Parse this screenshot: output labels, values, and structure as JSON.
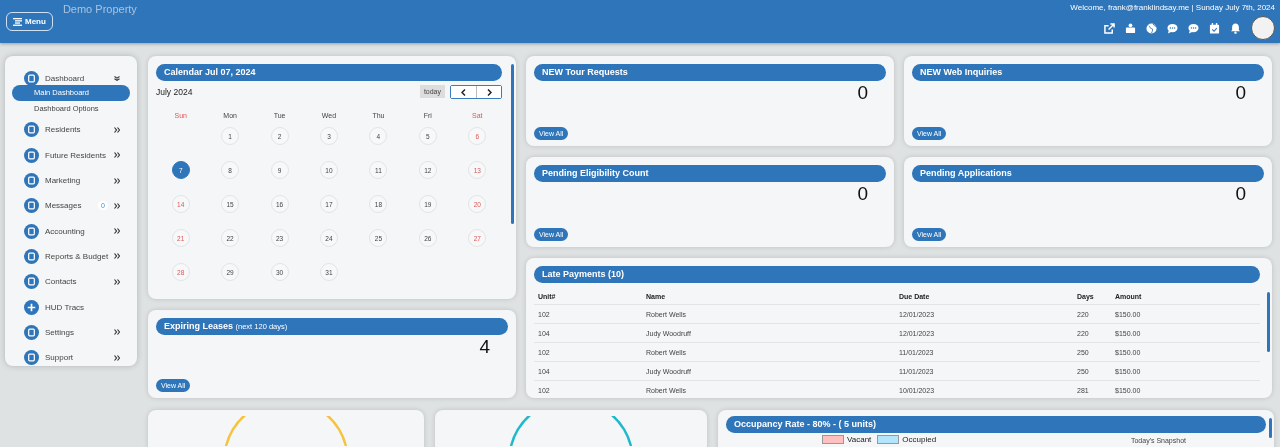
{
  "header": {
    "menu_button": "Menu",
    "property": "Demo Property",
    "welcome": "Welcome, frank@franklindsay.me | Sunday July 7th, 2024"
  },
  "sidebar": {
    "items": [
      {
        "label": "Dashboard",
        "expandable": true,
        "expanded": true,
        "children": [
          {
            "label": "Main Dashboard",
            "selected": true
          },
          {
            "label": "Dashboard Options",
            "selected": false
          }
        ]
      },
      {
        "label": "Residents",
        "expandable": true,
        "expanded": false
      },
      {
        "label": "Future Residents",
        "expandable": true,
        "expanded": false
      },
      {
        "label": "Marketing",
        "expandable": true,
        "expanded": false
      },
      {
        "label": "Messages",
        "expandable": true,
        "expanded": false,
        "badge": "0"
      },
      {
        "label": "Accounting",
        "expandable": true,
        "expanded": false
      },
      {
        "label": "Reports & Budget",
        "expandable": true,
        "expanded": false
      },
      {
        "label": "Contacts",
        "expandable": true,
        "expanded": false
      },
      {
        "label": "HUD Tracs",
        "expandable": false
      },
      {
        "label": "Settings",
        "expandable": true,
        "expanded": false
      },
      {
        "label": "Support",
        "expandable": true,
        "expanded": false
      }
    ]
  },
  "calendar": {
    "title": "Calendar Jul 07, 2024",
    "month": "July 2024",
    "today_button": "today",
    "weekdays": [
      "Sun",
      "Mon",
      "Tue",
      "Wed",
      "Thu",
      "Fri",
      "Sat"
    ],
    "weeks": [
      [
        {
          "day": "1",
          "selected": false
        },
        {
          "day": "2",
          "selected": false
        },
        {
          "day": "3",
          "selected": false
        },
        {
          "day": "4",
          "selected": false
        },
        {
          "day": "5",
          "selected": false
        },
        {
          "day": "6",
          "selected": false
        }
      ],
      [
        {
          "day": "7",
          "selected": true
        },
        {
          "day": "8",
          "selected": false
        },
        {
          "day": "9",
          "selected": false
        },
        {
          "day": "10",
          "selected": false
        },
        {
          "day": "11",
          "selected": false
        },
        {
          "day": "12",
          "selected": false
        },
        {
          "day": "13",
          "selected": false
        }
      ],
      [
        {
          "day": "14",
          "selected": false
        },
        {
          "day": "15",
          "selected": false
        },
        {
          "day": "16",
          "selected": false
        },
        {
          "day": "17",
          "selected": false
        },
        {
          "day": "18",
          "selected": false
        },
        {
          "day": "19",
          "selected": false
        },
        {
          "day": "20",
          "selected": false
        }
      ],
      [
        {
          "day": "21",
          "selected": false
        },
        {
          "day": "22",
          "selected": false
        },
        {
          "day": "23",
          "selected": false
        },
        {
          "day": "24",
          "selected": false
        },
        {
          "day": "25",
          "selected": false
        },
        {
          "day": "26",
          "selected": false
        },
        {
          "day": "27",
          "selected": false
        }
      ],
      [
        {
          "day": "28",
          "selected": false
        },
        {
          "day": "29",
          "selected": false
        },
        {
          "day": "30",
          "selected": false
        },
        {
          "day": "31",
          "selected": false
        }
      ]
    ]
  },
  "stat_cards": [
    {
      "title": "NEW Tour Requests",
      "value": "0",
      "button": "View All"
    },
    {
      "title": "NEW Web Inquiries",
      "value": "0",
      "button": "View All"
    },
    {
      "title": "Pending Eligibility Count",
      "value": "0",
      "button": "View All"
    },
    {
      "title": "Pending Applications",
      "value": "0",
      "button": "View All"
    }
  ],
  "expiring_leases": {
    "title": "Expiring Leases",
    "subtitle": "(next 120 days)",
    "value": "4",
    "button": "View All"
  },
  "late_payments": {
    "title": "Late Payments (10)",
    "columns": [
      "Unit#",
      "Name",
      "Due Date",
      "Days",
      "Amount"
    ],
    "rows": [
      [
        "102",
        "Robert Wells",
        "12/01/2023",
        "220",
        "$150.00"
      ],
      [
        "104",
        "Judy Woodruff",
        "12/01/2023",
        "220",
        "$150.00"
      ],
      [
        "102",
        "Robert Wells",
        "11/01/2023",
        "250",
        "$150.00"
      ],
      [
        "104",
        "Judy Woodruff",
        "11/01/2023",
        "250",
        "$150.00"
      ],
      [
        "102",
        "Robert Wells",
        "10/01/2023",
        "281",
        "$150.00"
      ]
    ]
  },
  "gauges": [
    {
      "color": "#f7c23e"
    },
    {
      "color": "#1fb9c9"
    }
  ],
  "occupancy": {
    "title": "Occupancy Rate - 80% - ( 5 units)",
    "legend": [
      {
        "label": "Vacant",
        "color": "#ffc0c0"
      },
      {
        "label": "Occupied",
        "color": "#b3e5fc"
      }
    ],
    "snapshot": "Today's Snapshot"
  }
}
